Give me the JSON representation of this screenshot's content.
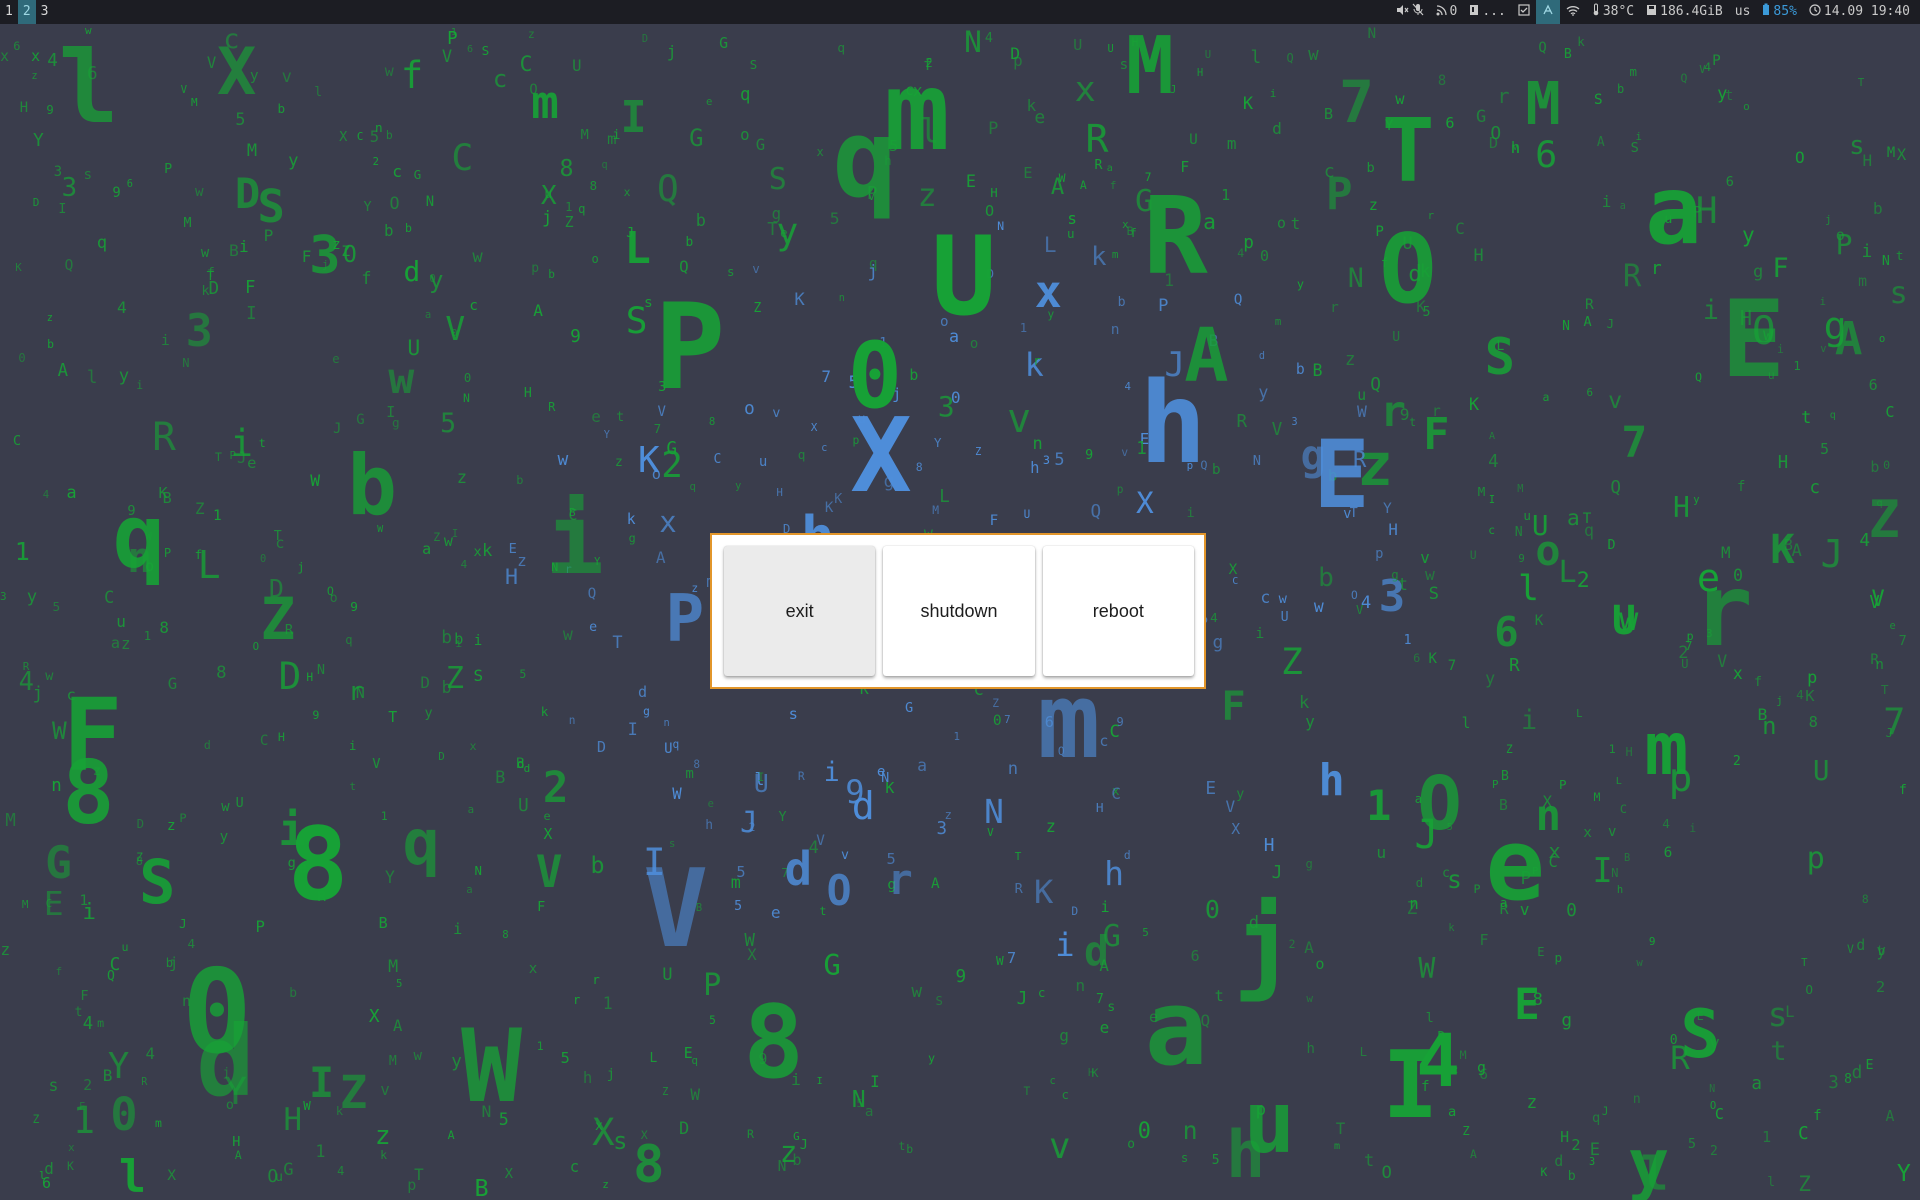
{
  "workspaces": [
    {
      "label": "1",
      "active": false
    },
    {
      "label": "2",
      "active": true
    },
    {
      "label": "3",
      "active": false
    }
  ],
  "status": {
    "volume": {
      "icon": "volume-muted-icon"
    },
    "mic": {
      "icon": "mic-muted-icon"
    },
    "rss": {
      "icon": "rss-icon",
      "text": "0"
    },
    "notes": {
      "icon": "bookmark-icon",
      "text": "..."
    },
    "tasks": {
      "icon": "checkbox-icon"
    },
    "vpn": {
      "icon": "network-icon"
    },
    "wifi": {
      "icon": "wifi-icon"
    },
    "temperature": {
      "icon": "thermometer-icon",
      "text": "38°C"
    },
    "disk": {
      "icon": "disk-icon",
      "text": "186.4GiB"
    },
    "keyboard_layout": {
      "text": "us"
    },
    "battery": {
      "icon": "battery-icon",
      "text": "85%"
    },
    "clock": {
      "icon": "clock-icon",
      "text": "14.09 19:40"
    }
  },
  "power_menu": {
    "buttons": [
      {
        "label": "exit",
        "selected": true
      },
      {
        "label": "shutdown",
        "selected": false
      },
      {
        "label": "reboot",
        "selected": false
      }
    ]
  },
  "colors": {
    "background": "#3a3d4c",
    "matrix_green": "#17a336",
    "matrix_blue": "#4f8fdc",
    "dialog_border": "#e2962b",
    "bar_background": "#1c1d23",
    "workspace_active": "#2f6a7a"
  }
}
